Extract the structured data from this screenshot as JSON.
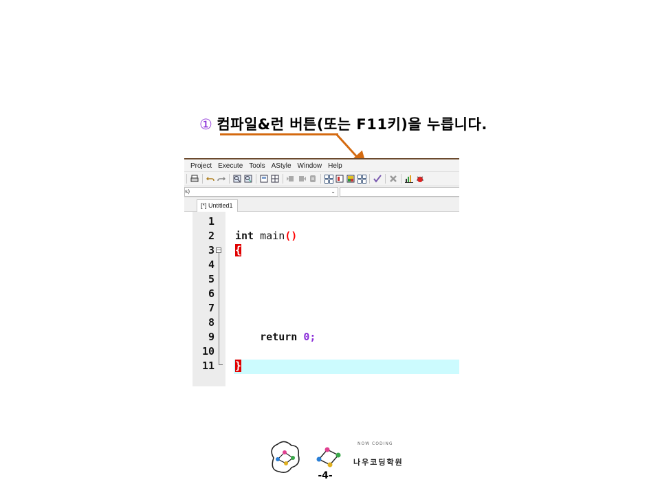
{
  "caption": {
    "number": "①",
    "text": "컴파일&런 버튼(또는 F11키)을 누릅니다."
  },
  "menubar": {
    "items": [
      "Project",
      "Execute",
      "Tools",
      "AStyle",
      "Window",
      "Help"
    ]
  },
  "combo": {
    "value": "s)"
  },
  "tab": {
    "label": "[*] Untitled1"
  },
  "editor": {
    "line_numbers": [
      "1",
      "2",
      "3",
      "4",
      "5",
      "6",
      "7",
      "8",
      "9",
      "10",
      "11"
    ],
    "lines": [
      {
        "kw": "int",
        "rest": "main",
        "paren": "()"
      },
      {
        "brace": "{"
      },
      {
        "kw": "return",
        "num": "0",
        "semi": ";"
      },
      {
        "brace": "}"
      }
    ]
  },
  "footer": {
    "brand_arc": "NOW CODING",
    "brand_name": "나우코딩학원",
    "page_number": "-4-"
  },
  "colors": {
    "accent_arrow": "#d46a10",
    "highlight_circle": "#e01010",
    "current_line": "#ccfbfe",
    "brace_match": "#e00000"
  },
  "icons": [
    "print-icon",
    "undo-icon",
    "redo-icon",
    "find-icon",
    "replace-icon",
    "compile-icon",
    "run-icon",
    "compile-run-icon",
    "rebuild-icon",
    "check-icon",
    "stop-icon",
    "chart-icon",
    "debug-icon"
  ]
}
